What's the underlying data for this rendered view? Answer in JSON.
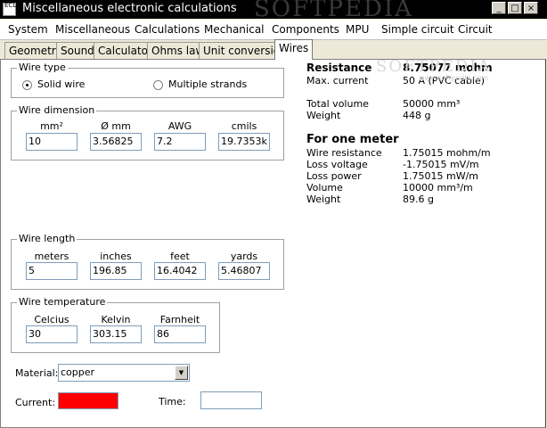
{
  "window": {
    "title": "Miscellaneous electronic calculations",
    "app_icon_label": "ECL",
    "watermark": "SOFTPEDIA",
    "controls": [
      "_",
      "□",
      "×"
    ]
  },
  "menu": [
    "System",
    "Miscellaneous",
    "Calculations",
    "Mechanical",
    "Components",
    "MPU",
    "Simple circuit",
    "Circuit"
  ],
  "tabs": [
    "Geometry",
    "Sound",
    "Calculator",
    "Ohms law",
    "Unit conversion",
    "Wires"
  ],
  "active_tab": "Wires",
  "wire_type": {
    "legend": "Wire type",
    "options": [
      "Solid wire",
      "Multiple strands"
    ],
    "selected": "Solid wire"
  },
  "wire_dimension": {
    "legend": "Wire dimension",
    "headers": [
      "mm²",
      "Ø mm",
      "AWG",
      "cmils"
    ],
    "values": [
      "10",
      "3.56825",
      "7.2",
      "19.7353k"
    ]
  },
  "wire_length": {
    "legend": "Wire length",
    "headers": [
      "meters",
      "inches",
      "feet",
      "yards"
    ],
    "values": [
      "5",
      "196.85",
      "16.4042",
      "5.46807"
    ]
  },
  "wire_temperature": {
    "legend": "Wire temperature",
    "headers": [
      "Celcius",
      "Kelvin",
      "Farnheit"
    ],
    "values": [
      "30",
      "303.15",
      "86"
    ]
  },
  "material": {
    "label": "Material:",
    "value": "copper"
  },
  "current": {
    "label": "Current:",
    "color": "#ff0000"
  },
  "time": {
    "label": "Time:",
    "value": ""
  },
  "results": {
    "resistance": {
      "label": "Resistance",
      "value": "8.75077 mohm"
    },
    "max_current": {
      "label": "Max. current",
      "value": "50 A  (PVC cable)"
    },
    "total_volume": {
      "label": "Total volume",
      "value": "50000 mm³"
    },
    "weight": {
      "label": "Weight",
      "value": "448 g"
    },
    "per_meter_heading": "For one meter",
    "per_meter": [
      {
        "label": "Wire resistance",
        "value": "1.75015 mohm/m"
      },
      {
        "label": "Loss voltage",
        "value": "-1.75015 mV/m"
      },
      {
        "label": "Loss power",
        "value": "1.75015 mW/m"
      },
      {
        "label": "Volume",
        "value": "10000 mm³/m"
      },
      {
        "label": "Weight",
        "value": "89.6 g"
      }
    ],
    "watermark": "SOFTPEDIA",
    "watermark_url": "www.softpedia.com"
  }
}
